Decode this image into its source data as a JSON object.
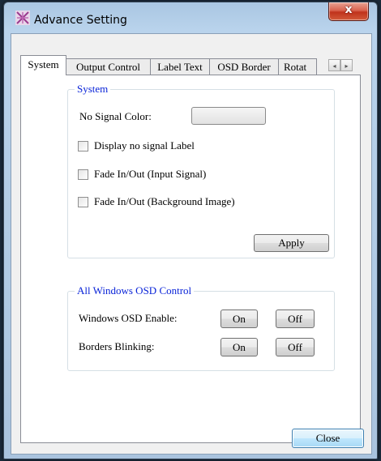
{
  "window": {
    "title": "Advance Setting",
    "close_glyph": "x"
  },
  "tabs": [
    {
      "label": "System",
      "active": true
    },
    {
      "label": "Output Control",
      "active": false
    },
    {
      "label": "Label Text",
      "active": false
    },
    {
      "label": "OSD Border",
      "active": false
    },
    {
      "label": "Rotat",
      "active": false
    }
  ],
  "tab_scroll": {
    "left": "◂",
    "right": "▸"
  },
  "system_group": {
    "legend": "System",
    "no_signal_color_label": "No Signal Color:",
    "checkboxes": [
      {
        "label": "Display no signal Label",
        "checked": false
      },
      {
        "label": "Fade In/Out (Input Signal)",
        "checked": false
      },
      {
        "label": "Fade In/Out (Background Image)",
        "checked": false
      }
    ],
    "apply_label": "Apply"
  },
  "osd_group": {
    "legend": "All Windows OSD Control",
    "rows": [
      {
        "label": "Windows OSD Enable:",
        "on": "On",
        "off": "Off"
      },
      {
        "label": "Borders Blinking:",
        "on": "On",
        "off": "Off"
      }
    ]
  },
  "footer": {
    "close_label": "Close"
  },
  "colors": {
    "legend": "#0a24d8",
    "close_red": "#c0321c"
  }
}
